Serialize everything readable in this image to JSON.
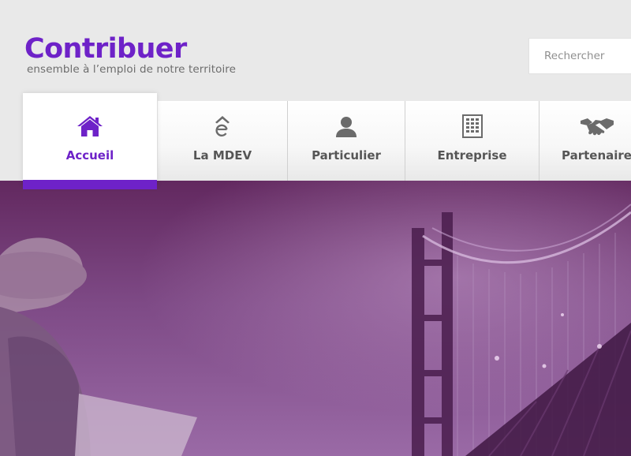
{
  "brand": {
    "title": "Contribuer",
    "tagline": "ensemble à l’emploi de notre territoire"
  },
  "search": {
    "placeholder": "Rechercher"
  },
  "nav": {
    "items": [
      {
        "label": "Accueil",
        "icon": "home-icon",
        "active": true
      },
      {
        "label": "La MDEV",
        "icon": "mdev-logo-icon",
        "active": false
      },
      {
        "label": "Particulier",
        "icon": "person-icon",
        "active": false
      },
      {
        "label": "Entreprise",
        "icon": "building-icon",
        "active": false
      },
      {
        "label": "Partenaire",
        "icon": "handshake-icon",
        "active": false
      }
    ]
  },
  "colors": {
    "accent": "#6e22c8",
    "hero_tint": "#7d4889",
    "nav_text": "#565656"
  }
}
